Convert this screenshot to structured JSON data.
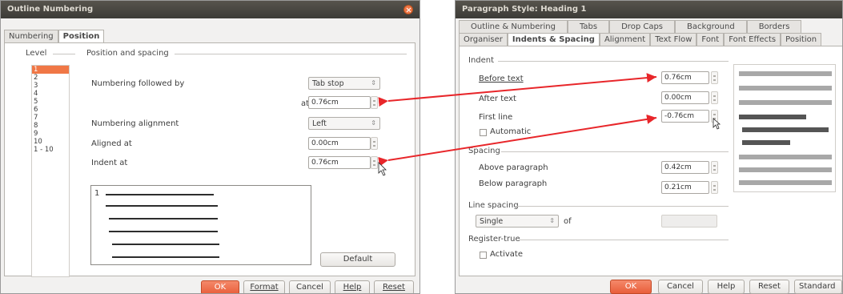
{
  "left_dialog": {
    "title": "Outline Numbering",
    "tabs": [
      "Numbering",
      "Position"
    ],
    "level_label": "Level",
    "position_group_label": "Position and spacing",
    "levels": [
      "1",
      "2",
      "3",
      "4",
      "5",
      "6",
      "7",
      "8",
      "9",
      "10",
      "1 - 10"
    ],
    "numbering_followed_by_label": "Numbering followed by",
    "numbering_followed_by_value": "Tab stop",
    "at_label": "at",
    "at_value": "0.76cm",
    "numbering_alignment_label": "Numbering alignment",
    "numbering_alignment_value": "Left",
    "aligned_at_label": "Aligned at",
    "aligned_at_value": "0.00cm",
    "indent_at_label": "Indent at",
    "indent_at_value": "0.76cm",
    "preview_number": "1",
    "default_button": "Default",
    "buttons": {
      "ok": "OK",
      "format": "Format",
      "cancel": "Cancel",
      "help": "Help",
      "reset": "Reset"
    }
  },
  "right_dialog": {
    "title": "Paragraph Style: Heading 1",
    "tabs_row1": [
      "Outline & Numbering",
      "Tabs",
      "Drop Caps",
      "Background",
      "Borders"
    ],
    "tabs_row2": [
      "Organiser",
      "Indents & Spacing",
      "Alignment",
      "Text Flow",
      "Font",
      "Font Effects",
      "Position"
    ],
    "indent_group": "Indent",
    "before_text_label": "Before text",
    "before_text_value": "0.76cm",
    "after_text_label": "After text",
    "after_text_value": "0.00cm",
    "first_line_label": "First line",
    "first_line_value": "-0.76cm",
    "automatic_label": "Automatic",
    "spacing_group": "Spacing",
    "above_paragraph_label": "Above paragraph",
    "above_paragraph_value": "0.42cm",
    "below_paragraph_label": "Below paragraph",
    "below_paragraph_value": "0.21cm",
    "line_spacing_group": "Line spacing",
    "line_spacing_value": "Single",
    "of_label": "of",
    "register_true_group": "Register-true",
    "activate_label": "Activate",
    "buttons": {
      "ok": "OK",
      "cancel": "Cancel",
      "help": "Help",
      "reset": "Reset",
      "standard": "Standard"
    }
  },
  "colors": {
    "accent": "#f07746",
    "annotation_arrow": "#e8262a"
  }
}
